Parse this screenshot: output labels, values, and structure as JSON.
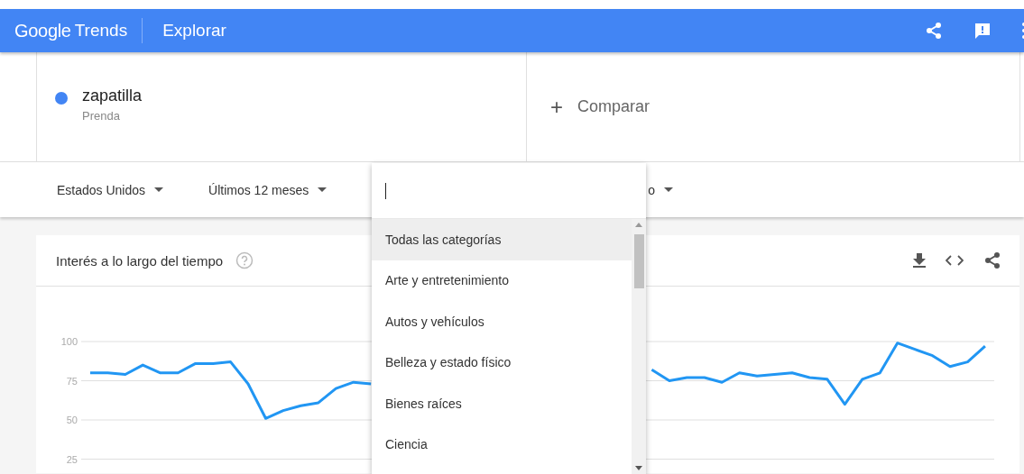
{
  "header": {
    "logo": [
      "Google",
      "Trends"
    ],
    "title": "Explorar"
  },
  "search_terms": [
    {
      "term": "zapatilla",
      "type": "Prenda",
      "color": "#4285f4"
    }
  ],
  "compare": {
    "icon": "+",
    "label": "Comparar"
  },
  "filters": [
    {
      "label": "Estados Unidos"
    },
    {
      "label": "Últimos 12 meses"
    },
    {
      "label": "o"
    }
  ],
  "category_dropdown": {
    "items": [
      {
        "label": "Todas las categorías",
        "selected": true
      },
      {
        "label": "Arte y entretenimiento",
        "selected": false
      },
      {
        "label": "Autos y vehículos",
        "selected": false
      },
      {
        "label": "Belleza y estado físico",
        "selected": false
      },
      {
        "label": "Bienes raíces",
        "selected": false
      },
      {
        "label": "Ciencia",
        "selected": false
      }
    ]
  },
  "interest_card": {
    "title": "Interés a lo largo del tiempo",
    "chart_data": {
      "type": "line",
      "grid": true,
      "ylim": [
        25,
        100
      ],
      "yticks": [
        25,
        50,
        75,
        100
      ],
      "series": [
        {
          "color": "#2196f3",
          "values": [
            80,
            80,
            79,
            85,
            80,
            80,
            86,
            86,
            87,
            73,
            51,
            56,
            59,
            61,
            70,
            74,
            73,
            null,
            null,
            null,
            null,
            null,
            null,
            null,
            null,
            null,
            null,
            null,
            null,
            null,
            null,
            null,
            82,
            75,
            77,
            77,
            74,
            80,
            78,
            79,
            80,
            77,
            76,
            60,
            76,
            80,
            99,
            95,
            91,
            84,
            87,
            97
          ]
        }
      ]
    }
  }
}
